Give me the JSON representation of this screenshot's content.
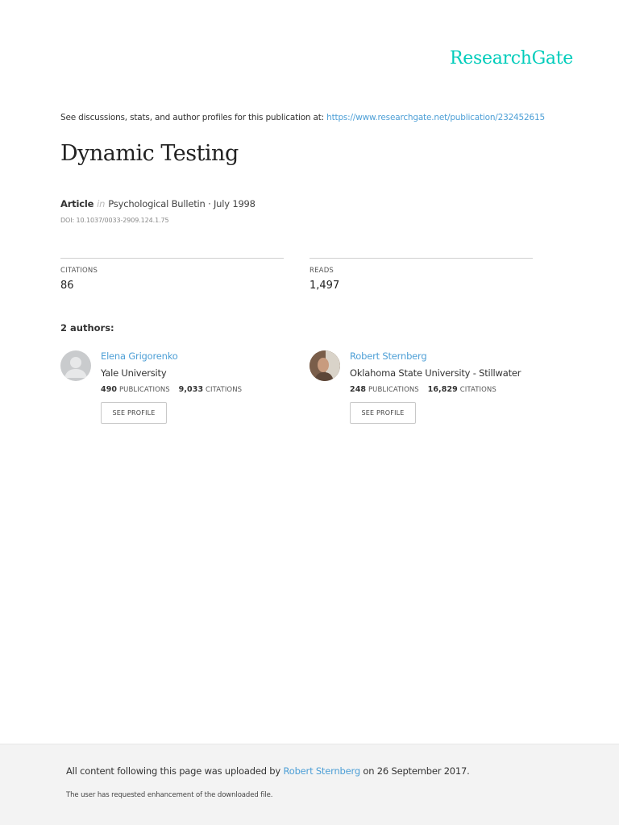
{
  "brand": {
    "logo_text": "ResearchGate",
    "accent_color": "#00CCBB",
    "link_color": "#4D9FD6"
  },
  "source": {
    "prefix": "See discussions, stats, and author profiles for this publication at:",
    "url": "https://www.researchgate.net/publication/232452615"
  },
  "publication": {
    "title": "Dynamic Testing",
    "type": "Article",
    "in_label": "in",
    "journal_date": "Psychological Bulletin · July 1998",
    "doi": "DOI: 10.1037/0033-2909.124.1.75"
  },
  "stats": {
    "citations_label": "CITATIONS",
    "citations_value": "86",
    "reads_label": "READS",
    "reads_value": "1,497"
  },
  "authors_heading": "2 authors:",
  "authors": [
    {
      "name": "Elena Grigorenko",
      "institution": "Yale University",
      "publications_count": "490",
      "publications_label": "PUBLICATIONS",
      "citations_count": "9,033",
      "citations_label": "CITATIONS",
      "button_label": "SEE PROFILE",
      "avatar_icon": "default-person-icon"
    },
    {
      "name": "Robert Sternberg",
      "institution": "Oklahoma State University - Stillwater",
      "publications_count": "248",
      "publications_label": "PUBLICATIONS",
      "citations_count": "16,829",
      "citations_label": "CITATIONS",
      "button_label": "SEE PROFILE",
      "avatar_icon": "profile-photo"
    }
  ],
  "footer": {
    "upload_prefix": "All content following this page was uploaded by",
    "uploader": "Robert Sternberg",
    "upload_suffix": "on 26 September 2017.",
    "enhancement_note": "The user has requested enhancement of the downloaded file."
  }
}
